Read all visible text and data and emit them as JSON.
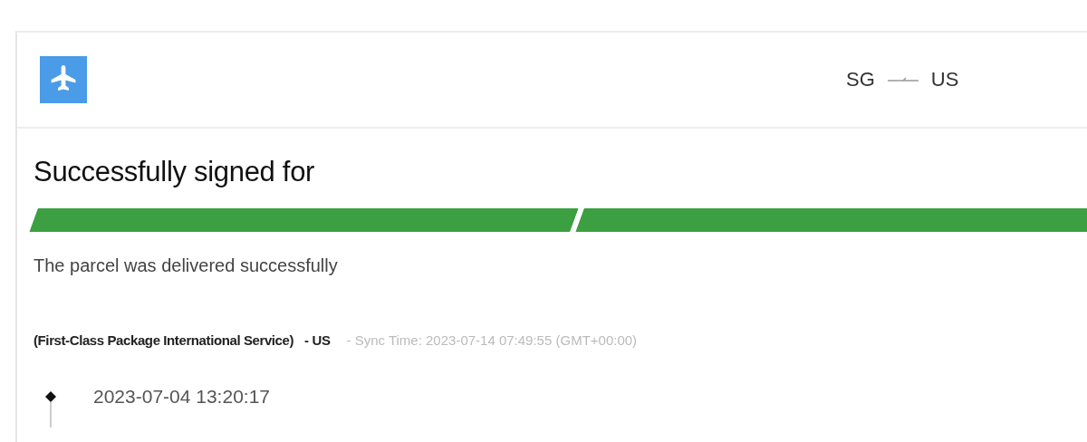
{
  "header": {
    "origin": "SG",
    "destination": "US"
  },
  "status": {
    "title": "Successfully signed for",
    "description": "The parcel was delivered successfully"
  },
  "progress": [
    {
      "level": 1
    },
    {
      "level": 1
    }
  ],
  "service": {
    "name": "(First-Class Package International Service)",
    "country": "- US",
    "sync": "- Sync Time: 2023-07-14 07:49:55 (GMT+00:00)"
  },
  "events": [
    {
      "time": "2023-07-04 13:20:17"
    }
  ]
}
